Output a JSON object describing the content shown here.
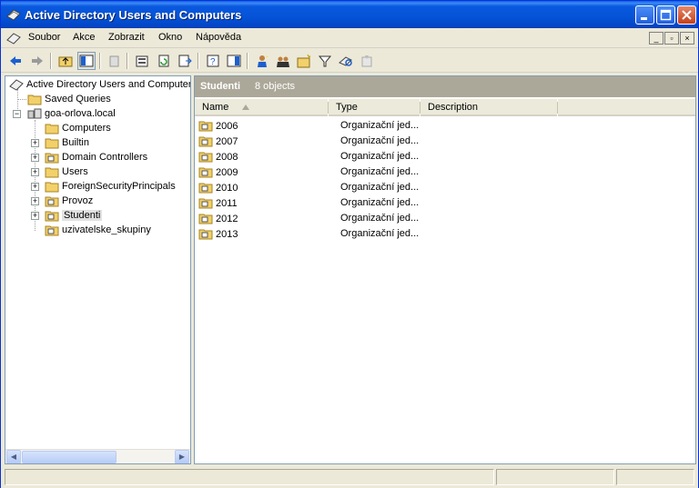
{
  "window": {
    "title": "Active Directory Users and Computers"
  },
  "menu": {
    "items": [
      "Soubor",
      "Akce",
      "Zobrazit",
      "Okno",
      "Nápověda"
    ]
  },
  "tree": {
    "root": "Active Directory Users and Computer",
    "saved_queries": "Saved Queries",
    "domain": "goa-orlova.local",
    "children": [
      "Computers",
      "Builtin",
      "Domain Controllers",
      "Users",
      "ForeignSecurityPrincipals",
      "Provoz",
      "Studenti",
      "uzivatelske_skupiny"
    ],
    "selected": "Studenti"
  },
  "details": {
    "title": "Studenti",
    "count": "8 objects",
    "columns": [
      "Name",
      "Type",
      "Description"
    ],
    "rows": [
      {
        "name": "2006",
        "type": "Organizační jed..."
      },
      {
        "name": "2007",
        "type": "Organizační jed..."
      },
      {
        "name": "2008",
        "type": "Organizační jed..."
      },
      {
        "name": "2009",
        "type": "Organizační jed..."
      },
      {
        "name": "2010",
        "type": "Organizační jed..."
      },
      {
        "name": "2011",
        "type": "Organizační jed..."
      },
      {
        "name": "2012",
        "type": "Organizační jed..."
      },
      {
        "name": "2013",
        "type": "Organizační jed..."
      }
    ]
  },
  "colors": {
    "titlebar": "#0553d6",
    "header_band": "#aca899",
    "folder": "#f2d16b"
  }
}
